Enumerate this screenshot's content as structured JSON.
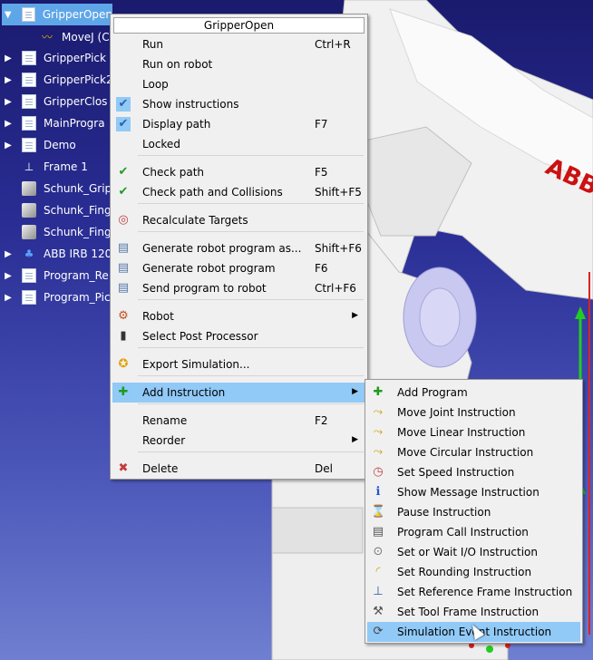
{
  "tree": {
    "items": [
      {
        "label": "GripperOpen",
        "arrow": "▼",
        "icon": "program-doc-icon",
        "selected": true
      },
      {
        "label": "MoveJ (C",
        "arrow": "",
        "icon": "movej-icon"
      },
      {
        "label": "GripperPick",
        "arrow": "▶",
        "icon": "program-doc-icon"
      },
      {
        "label": "GripperPick2",
        "arrow": "▶",
        "icon": "program-doc-icon"
      },
      {
        "label": "GripperClos",
        "arrow": "▶",
        "icon": "program-doc-icon"
      },
      {
        "label": "MainProgra",
        "arrow": "▶",
        "icon": "program-doc-icon"
      },
      {
        "label": "Demo",
        "arrow": "▶",
        "icon": "program-doc-icon"
      },
      {
        "label": "Frame 1",
        "arrow": "",
        "icon": "frame-icon"
      },
      {
        "label": "Schunk_Grip",
        "arrow": "",
        "icon": "object-icon"
      },
      {
        "label": "Schunk_Fing",
        "arrow": "",
        "icon": "object-icon"
      },
      {
        "label": "Schunk_Fing",
        "arrow": "",
        "icon": "object-icon"
      },
      {
        "label": "ABB IRB 120",
        "arrow": "▶",
        "icon": "robot-icon"
      },
      {
        "label": "Program_Re",
        "arrow": "▶",
        "icon": "program-doc-icon"
      },
      {
        "label": "Program_Pic",
        "arrow": "▶",
        "icon": "program-doc-icon"
      }
    ]
  },
  "context_menu": {
    "title": "GripperOpen",
    "items": [
      {
        "label": "Run",
        "shortcut": "Ctrl+R",
        "icon": ""
      },
      {
        "label": "Run on robot",
        "shortcut": "",
        "icon": ""
      },
      {
        "label": "Loop",
        "shortcut": "",
        "icon": ""
      },
      {
        "label": "Show instructions",
        "shortcut": "",
        "icon": "checkmark-icon"
      },
      {
        "label": "Display path",
        "shortcut": "F7",
        "icon": "checkmark-icon"
      },
      {
        "label": "Locked",
        "shortcut": "",
        "icon": ""
      },
      {
        "label": "Check path",
        "shortcut": "F5",
        "icon": "green-check-icon"
      },
      {
        "label": "Check path and Collisions",
        "shortcut": "Shift+F5",
        "icon": "green-check-icon"
      },
      {
        "label": "Recalculate Targets",
        "shortcut": "",
        "icon": "target-icon"
      },
      {
        "label": "Generate robot program as...",
        "shortcut": "Shift+F6",
        "icon": "document-icon"
      },
      {
        "label": "Generate robot program",
        "shortcut": "F6",
        "icon": "document-icon"
      },
      {
        "label": "Send program to robot",
        "shortcut": "Ctrl+F6",
        "icon": "document-icon"
      },
      {
        "label": "Robot",
        "shortcut": "",
        "icon": "robot-icon",
        "submenu": true
      },
      {
        "label": "Select Post Processor",
        "shortcut": "",
        "icon": "post-processor-icon"
      },
      {
        "label": "Export Simulation...",
        "shortcut": "",
        "icon": "export-simulation-icon"
      },
      {
        "label": "Add Instruction",
        "shortcut": "",
        "icon": "green-plus-icon",
        "submenu": true,
        "highlighted": true
      },
      {
        "label": "Rename",
        "shortcut": "F2",
        "icon": ""
      },
      {
        "label": "Reorder",
        "shortcut": "",
        "icon": "",
        "submenu": true
      },
      {
        "label": "Delete",
        "shortcut": "Del",
        "icon": "delete-x-icon"
      }
    ]
  },
  "submenu": {
    "items": [
      {
        "label": "Add Program",
        "icon": "add-program-icon"
      },
      {
        "label": "Move Joint Instruction",
        "icon": "move-joint-icon"
      },
      {
        "label": "Move Linear Instruction",
        "icon": "move-linear-icon"
      },
      {
        "label": "Move Circular Instruction",
        "icon": "move-circular-icon"
      },
      {
        "label": "Set Speed Instruction",
        "icon": "speed-gauge-icon"
      },
      {
        "label": "Show Message Instruction",
        "icon": "info-icon"
      },
      {
        "label": "Pause Instruction",
        "icon": "hourglass-icon"
      },
      {
        "label": "Program Call Instruction",
        "icon": "program-call-icon"
      },
      {
        "label": "Set or Wait I/O Instruction",
        "icon": "io-icon"
      },
      {
        "label": "Set Rounding Instruction",
        "icon": "rounding-icon"
      },
      {
        "label": "Set Reference Frame Instruction",
        "icon": "reference-frame-icon"
      },
      {
        "label": "Set Tool Frame Instruction",
        "icon": "tool-frame-icon"
      },
      {
        "label": "Simulation Event Instruction",
        "icon": "simulation-event-icon",
        "highlighted": true
      }
    ]
  },
  "colors": {
    "menu_highlight": "#91c9f7",
    "tree_selected": "#5ea6e8",
    "robot_body": "#f2f2f2",
    "robot_joint": "#c8c8f0",
    "brand_red": "#cc1111"
  }
}
